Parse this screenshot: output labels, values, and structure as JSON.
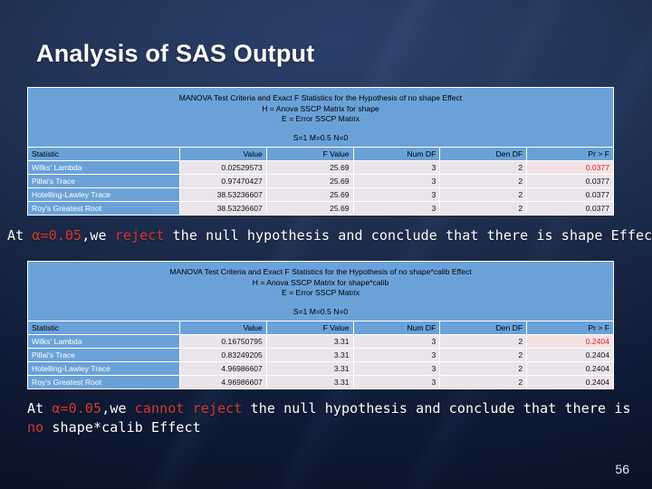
{
  "slide": {
    "title": "Analysis of SAS Output",
    "page_number": "56",
    "background_color": "#1a2847",
    "accent_color": "#6aa2d8",
    "highlight_color": "#d63a32"
  },
  "tables": [
    {
      "caption_lines": [
        "MANOVA Test Criteria and Exact F Statistics for the Hypothesis of no shape Effect",
        "H = Anova SSCP Matrix for shape",
        "E = Error SSCP Matrix"
      ],
      "parameters_line": "S=1    M=0.5    N=0",
      "columns": [
        "Statistic",
        "Value",
        "F Value",
        "Num DF",
        "Den DF",
        "Pr > F"
      ],
      "rows": [
        [
          "Wilks' Lambda",
          "0.02529573",
          "25.69",
          "3",
          "2",
          "0.0377"
        ],
        [
          "Pillai's Trace",
          "0.97470427",
          "25.69",
          "3",
          "2",
          "0.0377"
        ],
        [
          "Hotelling-Lawley Trace",
          "38.53236607",
          "25.69",
          "3",
          "2",
          "0.0377"
        ],
        [
          "Roy's Greatest Root",
          "38.53236607",
          "25.69",
          "3",
          "2",
          "0.0377"
        ]
      ],
      "highlight": {
        "row": 0,
        "col": 5
      }
    },
    {
      "caption_lines": [
        "MANOVA Test Criteria and Exact F Statistics for the Hypothesis of no shape*calib Effect",
        "H = Anova SSCP Matrix for shape*calib",
        "E = Error SSCP Matrix"
      ],
      "parameters_line": "S=1    M=0.5    N=0",
      "columns": [
        "Statistic",
        "Value",
        "F Value",
        "Num DF",
        "Den DF",
        "Pr > F"
      ],
      "rows": [
        [
          "Wilks' Lambda",
          "0.16750795",
          "3.31",
          "3",
          "2",
          "0.2404"
        ],
        [
          "Pillai's Trace",
          "0.83249205",
          "3.31",
          "3",
          "2",
          "0.2404"
        ],
        [
          "Hotelling-Lawley Trace",
          "4.96986607",
          "3.31",
          "3",
          "2",
          "0.2404"
        ],
        [
          "Roy's Greatest Root",
          "4.96986607",
          "3.31",
          "3",
          "2",
          "0.2404"
        ]
      ],
      "highlight": {
        "row": 0,
        "col": 5
      }
    }
  ],
  "conclusions": [
    {
      "segments": [
        {
          "text": "At ",
          "red": false
        },
        {
          "text": "α=0.05",
          "red": true
        },
        {
          "text": ",we ",
          "red": false
        },
        {
          "text": "reject",
          "red": true
        },
        {
          "text": " the null hypothesis and conclude that there is shape Effect",
          "red": false
        }
      ]
    },
    {
      "segments": [
        {
          "text": "At ",
          "red": false
        },
        {
          "text": "α=0.05",
          "red": true
        },
        {
          "text": ",we ",
          "red": false
        },
        {
          "text": "cannot reject",
          "red": true
        },
        {
          "text": " the null hypothesis and conclude that there is ",
          "red": false
        },
        {
          "text": "no",
          "red": true
        },
        {
          "text": " shape*calib Effect",
          "red": false
        }
      ]
    }
  ]
}
